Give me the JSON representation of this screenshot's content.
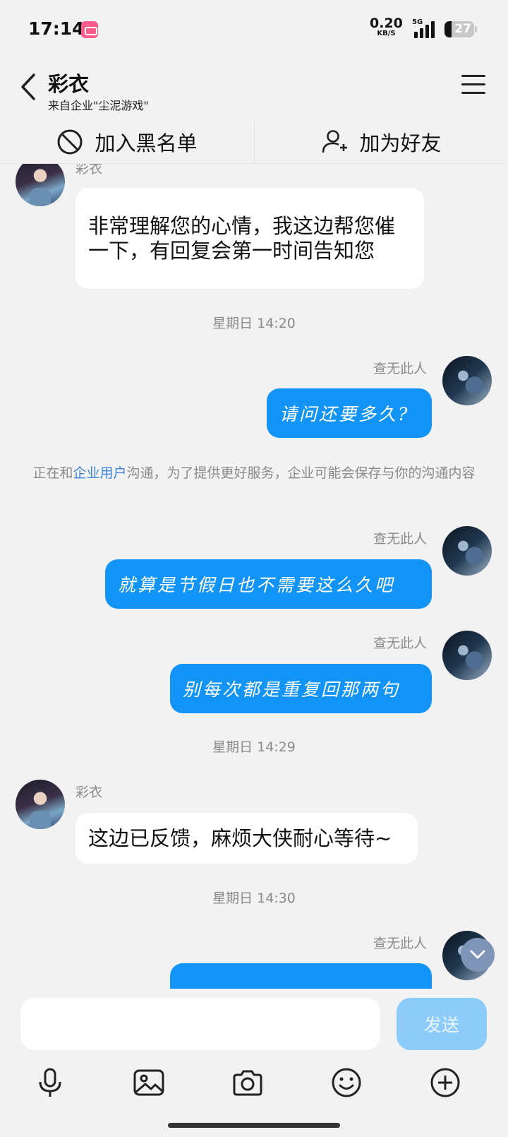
{
  "status_bar": {
    "time": "17:14",
    "net_speed": "0.20",
    "net_unit": "KB/S",
    "network": "5G",
    "battery": "27",
    "icons": [
      "bilibili-app-icon",
      "signal-icon",
      "battery-icon"
    ]
  },
  "header": {
    "title": "彩衣",
    "subtitle": "来自企业\"尘泥游戏\"",
    "icons": [
      "back-icon",
      "menu-icon"
    ]
  },
  "actions": {
    "block_label": "加入黑名单",
    "add_friend_label": "加为好友",
    "icons": [
      "block-icon",
      "add-friend-icon"
    ]
  },
  "chat": {
    "messages": [
      {
        "side": "in",
        "sender": "彩衣",
        "text": "非常理解您的心情，我这边帮您催一下，有回复会第一时间告知您"
      },
      {
        "type": "time",
        "text": "星期日 14:20"
      },
      {
        "side": "out",
        "sender": "查无此人",
        "text": "请问还要多久?"
      },
      {
        "type": "notice",
        "prefix": "正在和",
        "link": "企业用户",
        "suffix": "沟通，为了提供更好服务，企业可能会保存与你的沟通内容"
      },
      {
        "side": "out",
        "sender": "查无此人",
        "text": "就算是节假日也不需要这么久吧"
      },
      {
        "side": "out",
        "sender": "查无此人",
        "text": "别每次都是重复回那两句"
      },
      {
        "type": "time",
        "text": "星期日 14:29"
      },
      {
        "side": "in",
        "sender": "彩衣",
        "text": "这边已反馈，麻烦大侠耐心等待~"
      },
      {
        "type": "time",
        "text": "星期日 14:30"
      },
      {
        "side": "out",
        "sender": "查无此人",
        "text": ""
      }
    ]
  },
  "composer": {
    "placeholder": "",
    "send_label": "发送",
    "tools": [
      "microphone-icon",
      "image-icon",
      "camera-icon",
      "emoji-icon",
      "plus-icon"
    ]
  },
  "colors": {
    "background": "#f2f2f2",
    "bubble_out": "#1294f6",
    "bubble_in": "#ffffff",
    "send_disabled": "#8dcbfb",
    "link": "#3d85d8",
    "meta_text": "#8a8a8a"
  }
}
